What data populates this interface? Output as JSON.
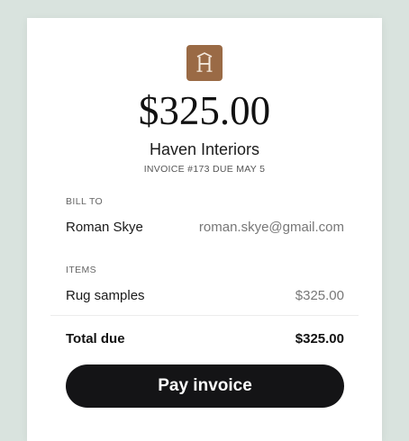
{
  "invoice": {
    "amount": "$325.00",
    "merchant": "Haven Interiors",
    "meta": "INVOICE #173 DUE MAY 5",
    "logo_icon": "house-logo-icon",
    "brand_color": "#9a6a45"
  },
  "bill_to": {
    "label": "BILL TO",
    "name": "Roman Skye",
    "email": "roman.skye@gmail.com"
  },
  "items": {
    "label": "ITEMS",
    "list": [
      {
        "name": "Rug samples",
        "price": "$325.00"
      }
    ]
  },
  "total": {
    "label": "Total due",
    "value": "$325.00"
  },
  "pay_button": {
    "label": "Pay invoice",
    "color": "#141416"
  }
}
